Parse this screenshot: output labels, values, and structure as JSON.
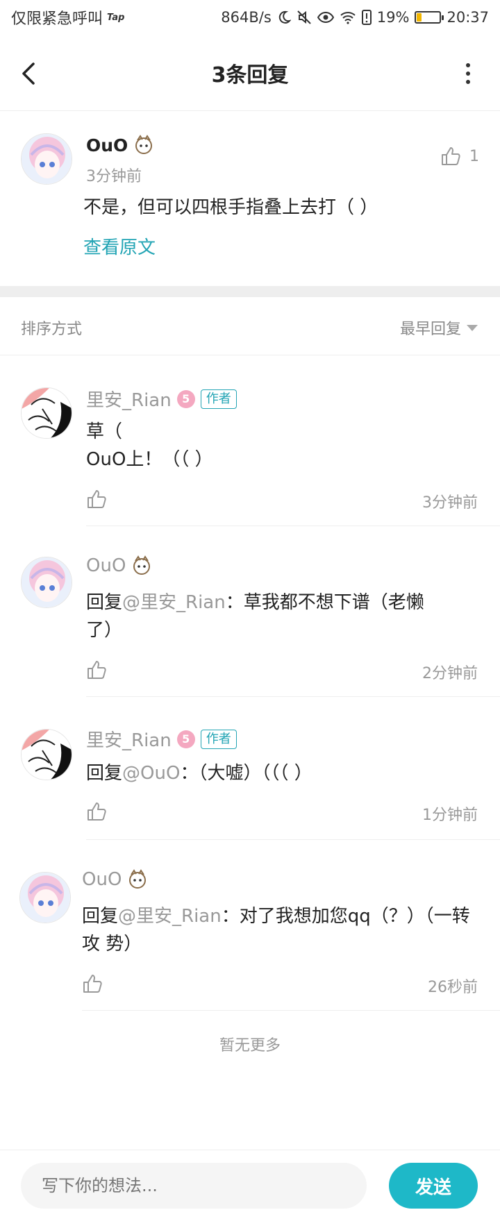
{
  "status_bar": {
    "carrier": "仅限紧急呼叫",
    "tap": "Tap",
    "speed": "864B/s",
    "battery": "19%",
    "battery_level": 0.19,
    "time": "20:37"
  },
  "header": {
    "title": "3条回复"
  },
  "origin": {
    "name": "OuO",
    "time": "3分钟前",
    "text": "不是，但可以四根手指叠上去打（ ）",
    "link": "查看原文",
    "likes": "1"
  },
  "sort": {
    "label": "排序方式",
    "value": "最早回复"
  },
  "replies": [
    {
      "name": "里安_Rian",
      "level": "5",
      "badge": "作者",
      "line1": "草（",
      "line2": "OuO上！（（ ）",
      "time": "3分钟前"
    },
    {
      "name": "OuO",
      "prefix": "回复",
      "mention": "@里安_Rian",
      "text": "：草我都不想下谱（老懒了）",
      "time": "2分钟前"
    },
    {
      "name": "里安_Rian",
      "level": "5",
      "badge": "作者",
      "prefix": "回复",
      "mention": "@OuO",
      "text": "：（大嘘）（（（ ）",
      "time": "1分钟前"
    },
    {
      "name": "OuO",
      "prefix": "回复",
      "mention": "@里安_Rian",
      "text": "：对了我想加您qq（？）（一转 攻 势）",
      "time": "26秒前"
    }
  ],
  "footer": {
    "no_more": "暂无更多"
  },
  "input": {
    "placeholder": "写下你的想法...",
    "send": "发送"
  },
  "colors": {
    "accent": "#1eb8c8",
    "link": "#22a4b4",
    "muted": "#999999"
  },
  "icons": [
    "back-arrow-icon",
    "more-vertical-icon",
    "thumbs-up-icon",
    "moon-icon",
    "mute-icon",
    "eye-icon",
    "wifi-icon",
    "alert-icon",
    "battery-icon",
    "level-badge-icon",
    "sticker-icon"
  ]
}
